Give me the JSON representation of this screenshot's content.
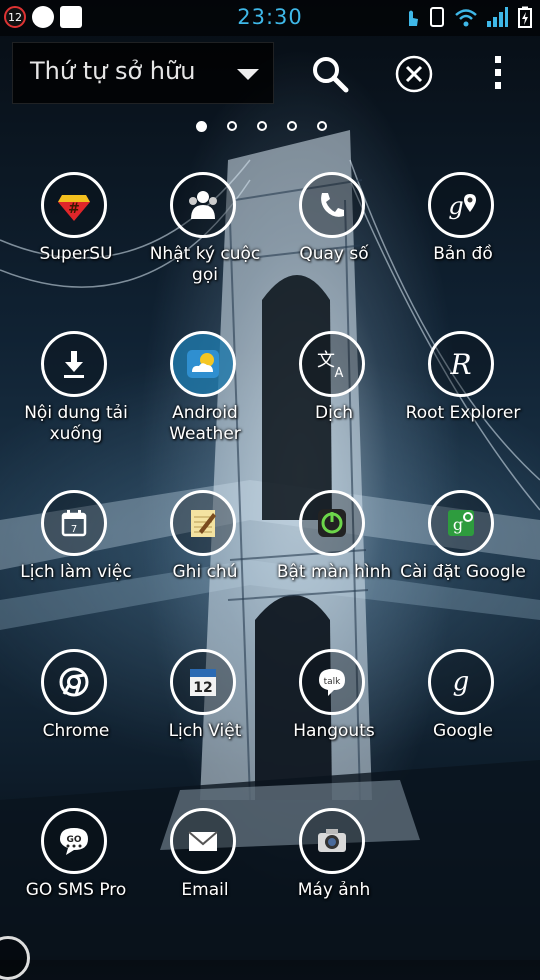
{
  "status_bar": {
    "notification_count": "12",
    "time": "23:30",
    "left_icons": [
      "notification-badge-icon",
      "s-app-icon",
      "image-icon"
    ],
    "right_icons": [
      "touch-icon",
      "phone-screen-icon",
      "wifi-icon",
      "signal-icon",
      "battery-charging-icon"
    ]
  },
  "toolbar": {
    "sort_label": "Thứ tự sở hữu",
    "icons": [
      "search-icon",
      "close-icon",
      "overflow-menu-icon"
    ]
  },
  "pager": {
    "pages": 5,
    "active_page": 1
  },
  "apps": [
    {
      "label": "SuperSU",
      "icon": "supersu-icon"
    },
    {
      "label": "Nhật ký cuộc gọi",
      "icon": "call-log-icon"
    },
    {
      "label": "Quay số",
      "icon": "phone-dialer-icon"
    },
    {
      "label": "Bản đồ",
      "icon": "maps-icon"
    },
    {
      "label": "Nội dung tải xuống",
      "icon": "download-icon"
    },
    {
      "label": "Android Weather",
      "icon": "weather-icon"
    },
    {
      "label": "Dịch",
      "icon": "translate-icon"
    },
    {
      "label": "Root Explorer",
      "icon": "root-explorer-icon"
    },
    {
      "label": "Lịch làm việc",
      "icon": "calendar-icon"
    },
    {
      "label": "Ghi chú",
      "icon": "notepad-icon"
    },
    {
      "label": "Bật màn hình",
      "icon": "power-icon"
    },
    {
      "label": "Cài đặt Google",
      "icon": "google-settings-icon"
    },
    {
      "label": "Chrome",
      "icon": "chrome-icon"
    },
    {
      "label": "Lịch Việt",
      "icon": "lich-viet-icon"
    },
    {
      "label": "Hangouts",
      "icon": "hangouts-icon"
    },
    {
      "label": "Google",
      "icon": "google-icon"
    },
    {
      "label": "GO SMS Pro",
      "icon": "go-sms-icon"
    },
    {
      "label": "Email",
      "icon": "email-icon"
    },
    {
      "label": "Máy ảnh",
      "icon": "camera-icon"
    }
  ],
  "colors": {
    "time": "#3fb8e8",
    "badge": "#d33333",
    "supersu": "#e0262a",
    "google_green": "#2e9c3e"
  }
}
